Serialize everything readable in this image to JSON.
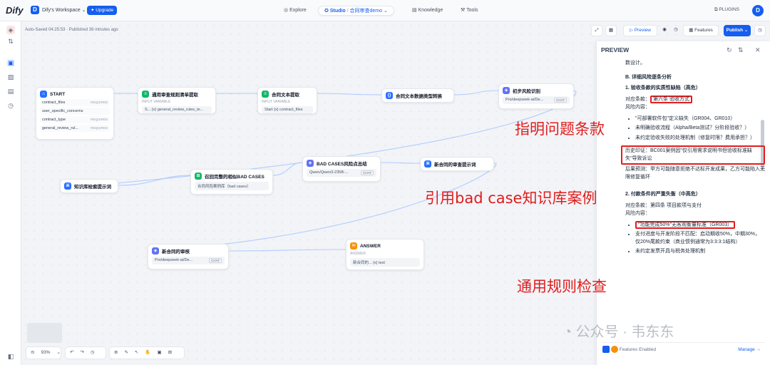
{
  "header": {
    "logo": "Dify",
    "workspace_initial": "D",
    "workspace_name": "Dify's Workspace ⌄",
    "upgrade_label": "Upgrade",
    "nav": {
      "explore": "Explore",
      "studio": "Studio",
      "app_name": "合同审查demo",
      "knowledge": "Knowledge",
      "tools": "Tools"
    },
    "plugins_label": "PLUGINS",
    "avatar_initial": "D"
  },
  "status": {
    "autosave": "Auto-Saved 04:25:53 · Published 39 minutes ago"
  },
  "toolbar": {
    "preview_label": "Preview",
    "features_label": "Features",
    "publish_label": "Publish ⌄"
  },
  "nodes": {
    "start": {
      "title": "START",
      "vars": [
        {
          "name": "contract_files",
          "req": "REQUIRED"
        },
        {
          "name": "user_specific_concerns",
          "req": ""
        },
        {
          "name": "contract_type",
          "req": "REQUIRED"
        },
        {
          "name": "general_review_rul...",
          "req": "REQUIRED"
        }
      ]
    },
    "n2": {
      "title": "通用审查规则清单提取",
      "sub": "INPUT VARIABLE",
      "body": "S... {x} general_review_rules_te..."
    },
    "n3": {
      "title": "合同文本提取",
      "sub": "INPUT VARIABLE",
      "body": "Start {x} contract_files"
    },
    "n4": {
      "title": "合同文本数据类型转换"
    },
    "n5": {
      "title": "初步风险识别",
      "body": "Pro/deepseek-ai/De...",
      "tag": "CHAT"
    },
    "n6": {
      "title": "知识库检索提示词"
    },
    "n7": {
      "title": "召回完整的相似BAD CASES",
      "body": "合同风险案例库（bad cases）"
    },
    "n8": {
      "title": "BAD CASES风险点总结",
      "body": "Qwen/Qwen3-235B-...",
      "tag": "CHAT"
    },
    "n9": {
      "title": "新合同的审查提示词"
    },
    "n10": {
      "title": "新合同的审核",
      "body": "Pro/deepseek-ai/De...",
      "tag": "CHAT"
    },
    "n11": {
      "title": "ANSWER",
      "sub": "ANSWER",
      "body": "新合同的... {x} text"
    }
  },
  "preview": {
    "title": "PREVIEW",
    "p0": "数设计。",
    "h_b": "B. 详细风险逐条分析",
    "item1_title": "1. 验收条款的实质性缺陷（高危）",
    "item1_clause_label": "对应条款：",
    "item1_clause": "第六条 验收方式",
    "item1_risk_label": "风险内容：",
    "item1_bullets": [
      "\"可部署软件包\"定义缺失（GR004、GR010）",
      "未明确验收流程（Alpha/Beta测试？分阶段验收？）",
      "未约定验收失败的处理机制（修复时限？费用承担？）"
    ],
    "item1_history": "历史印证：BC001案例因\"仅引用需求说明书但验收标准缺失\"导致诉讼",
    "item1_consequence": "后果预测：甲方可能随意拒绝不达标开发成果，乙方可能陷入无限修复循环",
    "item2_title": "2. 付款条件的严重失衡（中高危）",
    "item2_clause": "对应条款：第四条 项目款项与支付",
    "item2_risk_label": "风险内容：",
    "item2_bullets": [
      "\"功能完成50%\"无客观衡量标准（GR003）",
      "支付进度与开发阶段不匹配：启动期收50%，中期30%，仅20%尾款约束（商业惯例通常为3:3:3:1结构）",
      "未约定发票开具与税务处理机制"
    ],
    "footer_features": "Features Enabled",
    "footer_manage": "Manage →"
  },
  "annotations": {
    "a1": "指明问题条款",
    "a2": "引用bad case知识库案例",
    "a3": "通用规则检查"
  },
  "watermark": "公众号 · 韦东东",
  "bottom": {
    "zoom": "93%"
  },
  "colors": {
    "accent": "#155eef",
    "annotation": "#e11d1d"
  }
}
